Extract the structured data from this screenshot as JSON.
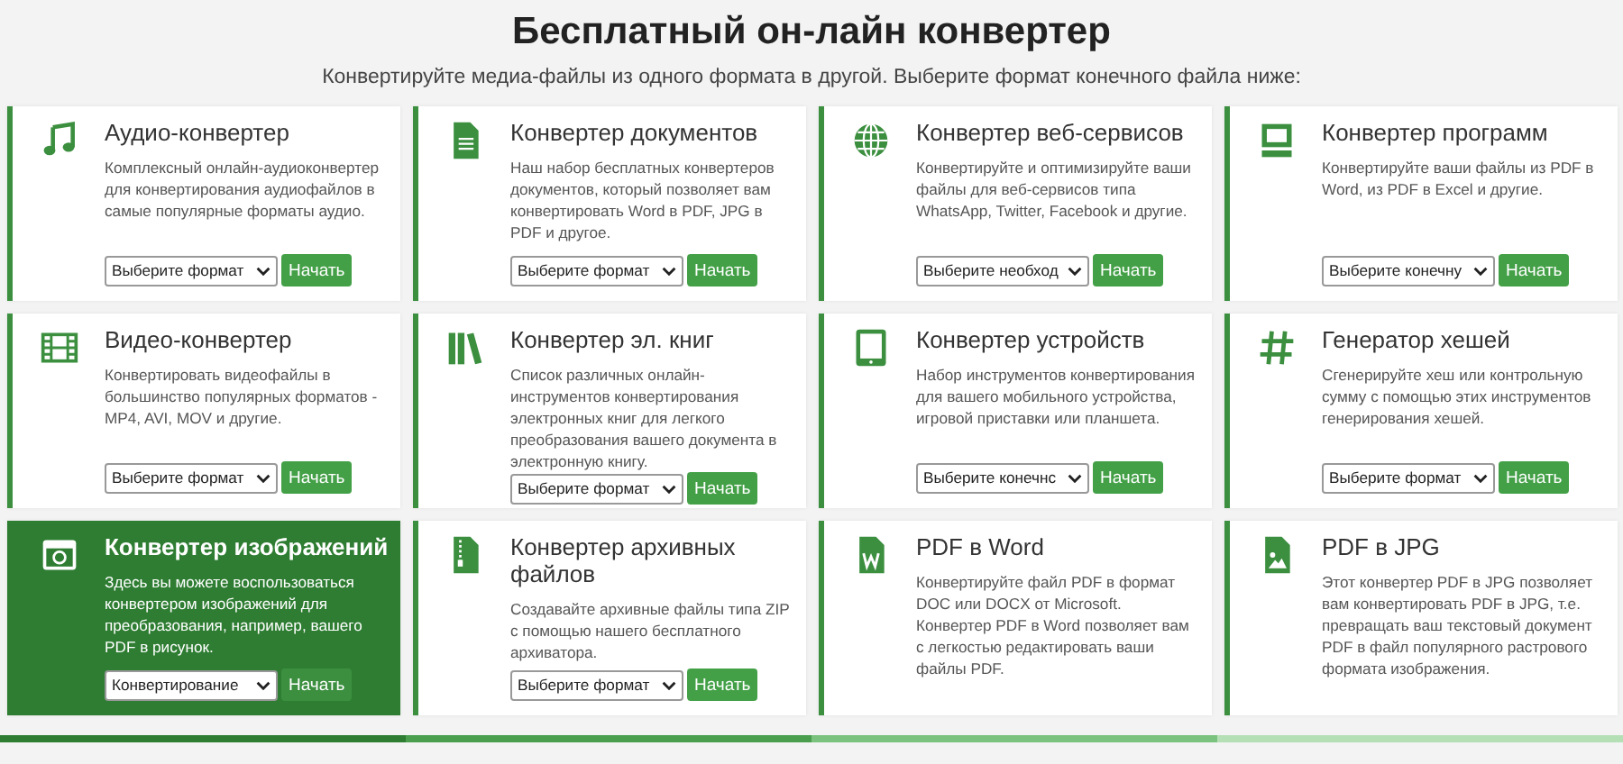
{
  "header": {
    "title": "Бесплатный он-лайн конвертер",
    "subtitle": "Конвертируйте медиа-файлы из одного формата в другой. Выберите формат конечного файла ниже:"
  },
  "cards": [
    {
      "title": "Аудио-конвертер",
      "description": "Комплексный онлайн-аудиоконвертер для конвертирования аудиофайлов в самые популярные форматы аудио.",
      "select": "Выберите формат",
      "button": "Начать",
      "selected": false
    },
    {
      "title": "Конвертер документов",
      "description": "Наш набор бесплатных конвертеров документов, который позволяет вам конвертировать Word в PDF, JPG в PDF и другое.",
      "select": "Выберите формат",
      "button": "Начать",
      "selected": false
    },
    {
      "title": "Конвертер веб-сервисов",
      "description": "Конвертируйте и оптимизируйте ваши файлы для веб-сервисов типа WhatsApp, Twitter, Facebook и другие.",
      "select": "Выберите необход",
      "button": "Начать",
      "selected": false
    },
    {
      "title": "Конвертер программ",
      "description": "Конвертируйте ваши файлы из PDF в Word, из PDF в Excel и другие.",
      "select": "Выберите конечну",
      "button": "Начать",
      "selected": false
    },
    {
      "title": "Видео-конвертер",
      "description": "Конвертировать видеофайлы в большинство популярных форматов - MP4, AVI, MOV и другие.",
      "select": "Выберите формат",
      "button": "Начать",
      "selected": false
    },
    {
      "title": "Конвертер эл. книг",
      "description": "Список различных онлайн-инструментов конвертирования электронных книг для легкого преобразования вашего документа в электронную книгу.",
      "select": "Выберите формат",
      "button": "Начать",
      "selected": false
    },
    {
      "title": "Конвертер устройств",
      "description": "Набор инструментов конвертирования для вашего мобильного устройства, игровой приставки или планшета.",
      "select": "Выберите конечнс",
      "button": "Начать",
      "selected": false
    },
    {
      "title": "Генератор хешей",
      "description": "Сгенерируйте хеш или контрольную сумму с помощью этих инструментов генерирования хешей.",
      "select": "Выберите формат",
      "button": "Начать",
      "selected": false
    },
    {
      "title": "Конвертер изображений",
      "description": "Здесь вы можете воспользоваться конвертером изображений для преобразования, например, вашего PDF в рисунок.",
      "select": "Конвертирование",
      "button": "Начать",
      "selected": true
    },
    {
      "title": "Конвертер архивных файлов",
      "description": "Создавайте архивные файлы типа ZIP с помощью нашего бесплатного архиватора.",
      "select": "Выберите формат",
      "button": "Начать",
      "selected": false
    },
    {
      "title": "PDF в Word",
      "description": "Конвертируйте файл PDF в формат DOC или DOCX от Microsoft. Конвертер PDF в Word позволяет вам с легкостью редактировать ваши файлы PDF.",
      "selected": false
    },
    {
      "title": "PDF в JPG",
      "description": "Этот конвертер PDF в JPG позволяет вам конвертировать PDF в JPG, т.е. превращать ваш текстовый документ PDF в файл популярного растрового формата изображения.",
      "selected": false
    }
  ]
}
